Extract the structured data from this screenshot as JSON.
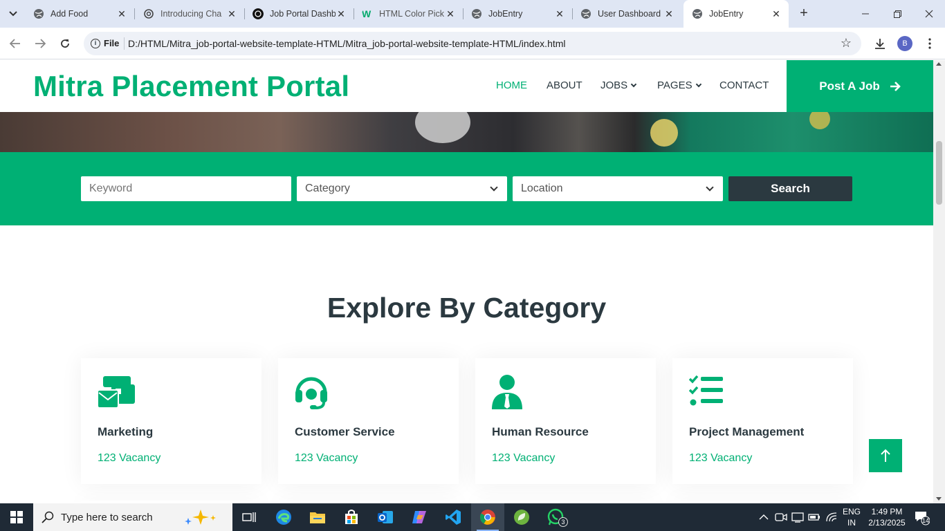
{
  "browser": {
    "tabs": [
      {
        "title": "Add Food",
        "favicon": "globe-icon",
        "active": false
      },
      {
        "title": "Introducing Cha",
        "favicon": "openai-icon",
        "active": false
      },
      {
        "title": "Job Portal Dashb",
        "favicon": "openai-icon",
        "active": false
      },
      {
        "title": "HTML Color Pick",
        "favicon": "w3schools-icon",
        "active": false
      },
      {
        "title": "JobEntry",
        "favicon": "globe-icon",
        "active": false
      },
      {
        "title": "User Dashboard",
        "favicon": "globe-icon",
        "active": false
      },
      {
        "title": "JobEntry",
        "favicon": "globe-icon",
        "active": true
      }
    ],
    "address": {
      "scheme_chip": "File",
      "url": "D:/HTML/Mitra_job-portal-website-template-HTML/Mitra_job-portal-website-template-HTML/index.html"
    },
    "profile_initial": "B"
  },
  "site": {
    "brand": "Mitra Placement Portal",
    "nav": [
      {
        "label": "HOME",
        "active": true,
        "dropdown": false
      },
      {
        "label": "ABOUT",
        "active": false,
        "dropdown": false
      },
      {
        "label": "JOBS",
        "active": false,
        "dropdown": true
      },
      {
        "label": "PAGES",
        "active": false,
        "dropdown": true
      },
      {
        "label": "CONTACT",
        "active": false,
        "dropdown": false
      }
    ],
    "post_job_label": "Post A Job",
    "search": {
      "keyword_placeholder": "Keyword",
      "category_value": "Category",
      "location_value": "Location",
      "button_label": "Search"
    },
    "section_title": "Explore By Category",
    "categories": [
      {
        "name": "Marketing",
        "vacancy": "123 Vacancy",
        "icon": "mail-bulk-icon"
      },
      {
        "name": "Customer Service",
        "vacancy": "123 Vacancy",
        "icon": "headset-icon"
      },
      {
        "name": "Human Resource",
        "vacancy": "123 Vacancy",
        "icon": "user-tie-icon"
      },
      {
        "name": "Project Management",
        "vacancy": "123 Vacancy",
        "icon": "tasks-icon"
      }
    ],
    "colors": {
      "primary": "#00B074",
      "dark": "#2B3940"
    }
  },
  "taskbar": {
    "search_placeholder": "Type here to search",
    "whatsapp_badge": "3",
    "language": [
      "ENG",
      "IN"
    ],
    "time": "1:49 PM",
    "date": "2/13/2025",
    "notification_count": "14"
  }
}
